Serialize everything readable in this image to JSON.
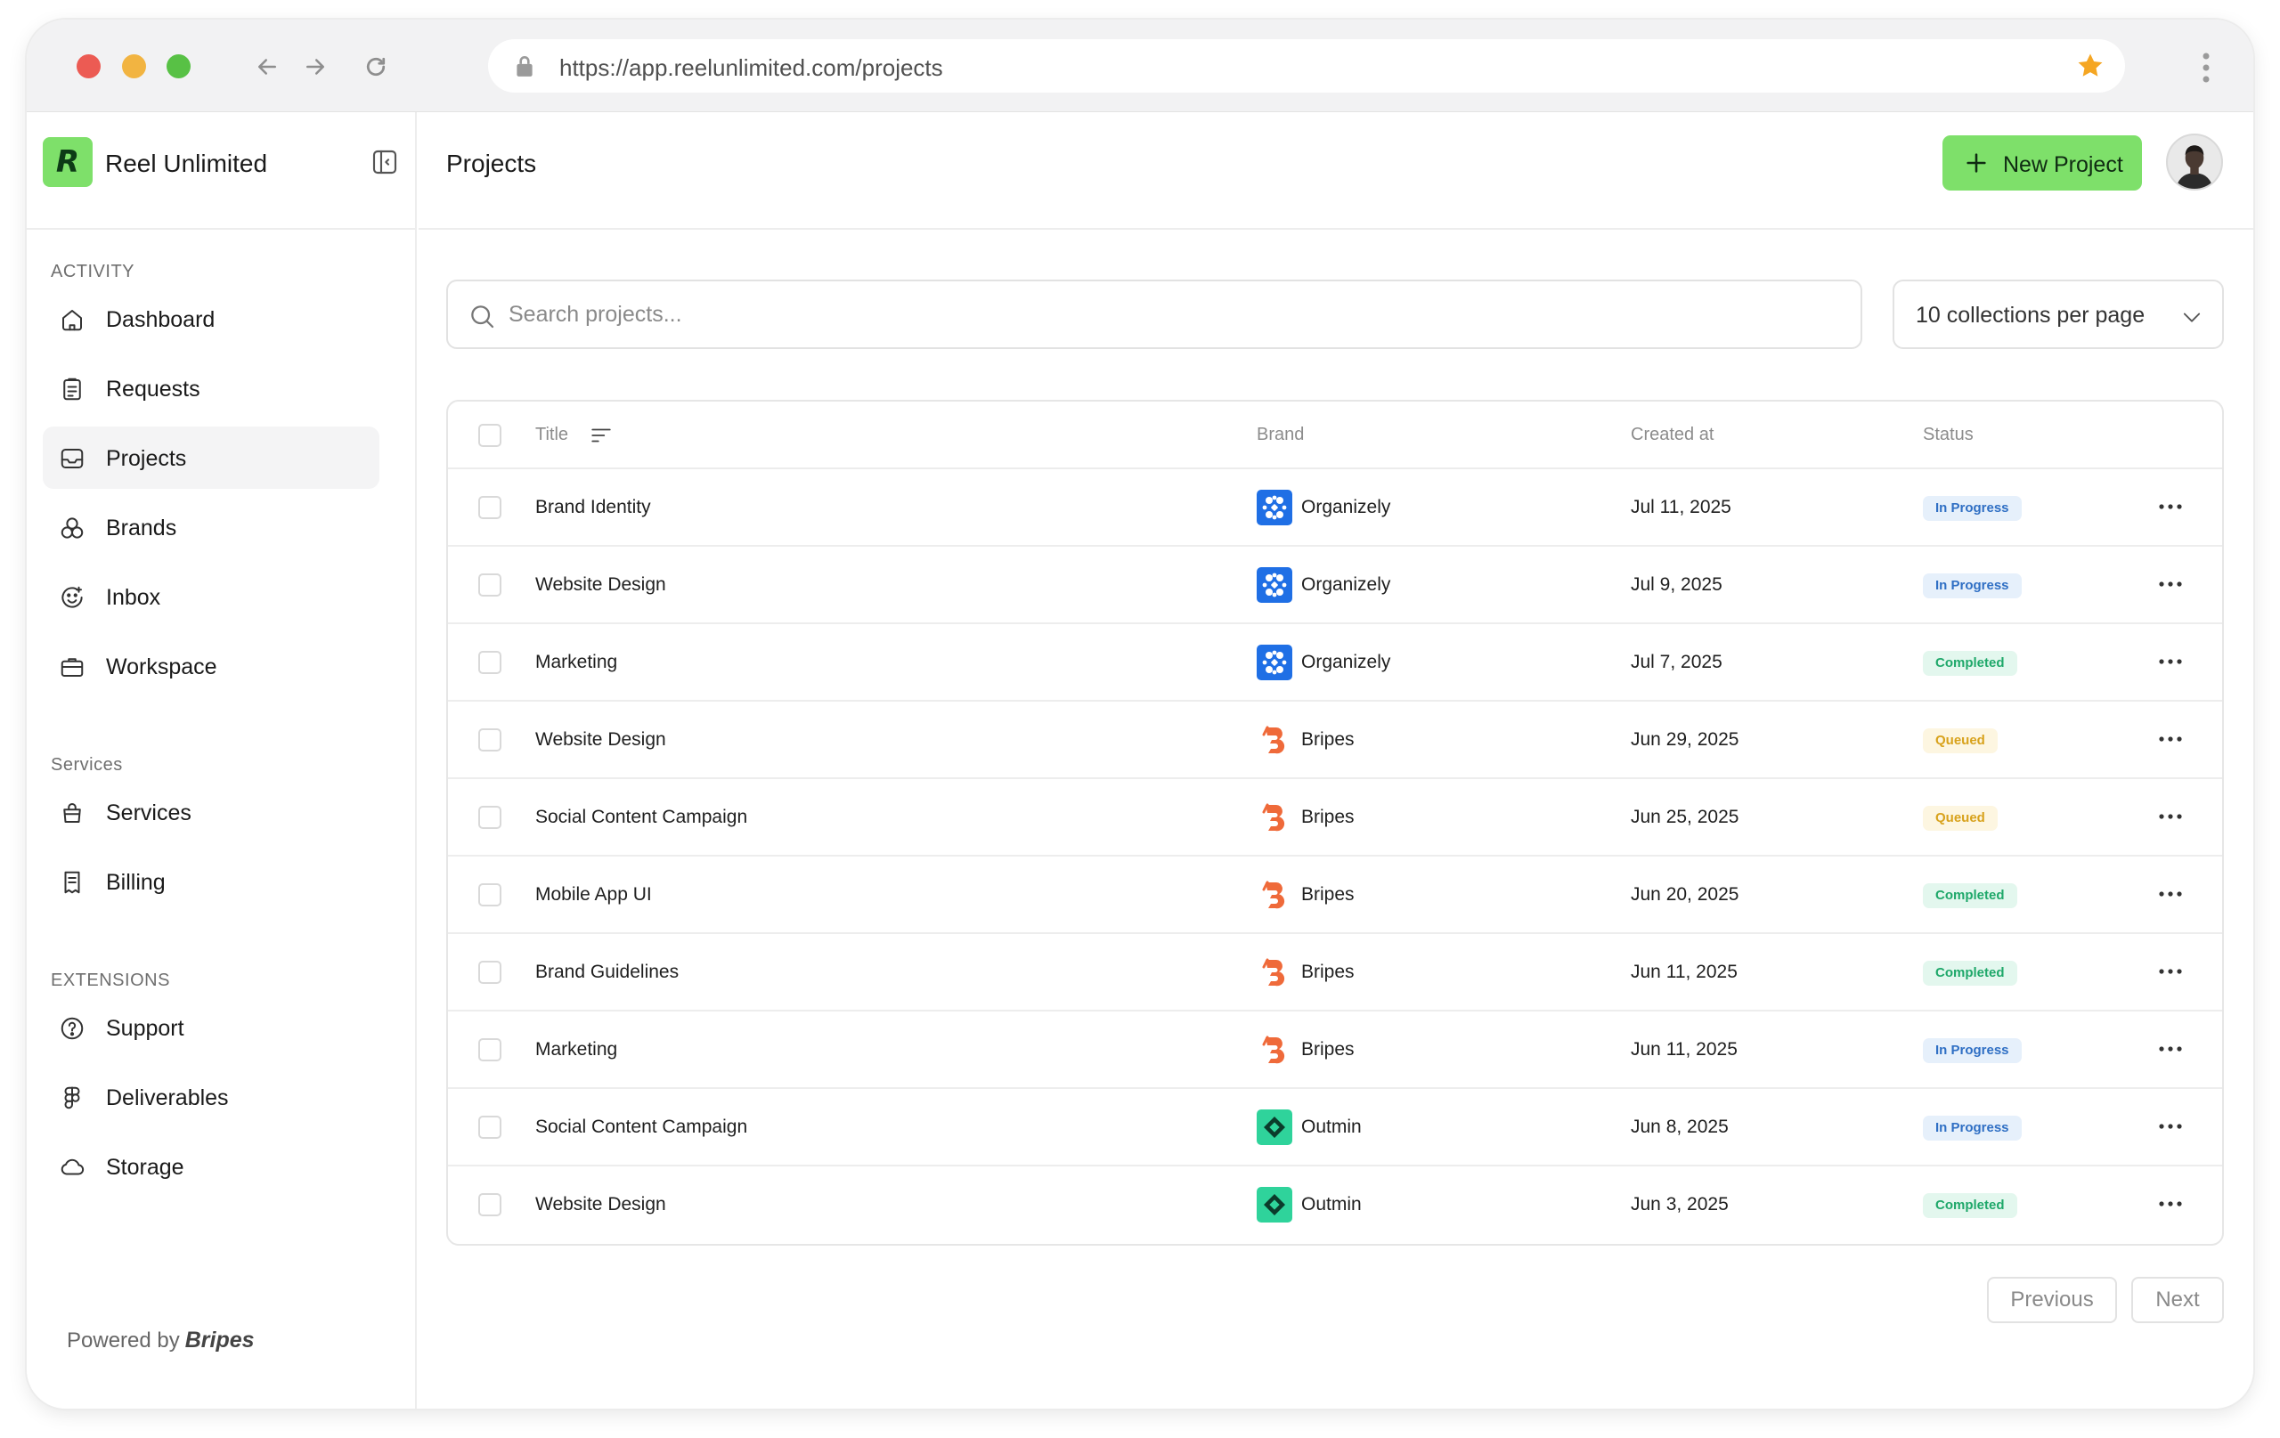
{
  "browser": {
    "url": "https://app.reelunlimited.com/projects"
  },
  "sidebar": {
    "logo_letter": "R",
    "app_name": "Reel Unlimited",
    "sections": [
      {
        "label": "ACTIVITY",
        "items": [
          {
            "label": "Dashboard",
            "icon": "home-icon"
          },
          {
            "label": "Requests",
            "icon": "clipboard-icon"
          },
          {
            "label": "Projects",
            "icon": "inbox-tray-icon",
            "active": true
          },
          {
            "label": "Brands",
            "icon": "shapes-icon"
          },
          {
            "label": "Inbox",
            "icon": "smile-chat-icon"
          },
          {
            "label": "Workspace",
            "icon": "briefcase-icon"
          }
        ]
      },
      {
        "label": "Services",
        "items": [
          {
            "label": "Services",
            "icon": "shopping-bag-icon"
          },
          {
            "label": "Billing",
            "icon": "receipt-icon"
          }
        ]
      },
      {
        "label": "EXTENSIONS",
        "items": [
          {
            "label": "Support",
            "icon": "question-circle-icon"
          },
          {
            "label": "Deliverables",
            "icon": "figma-icon"
          },
          {
            "label": "Storage",
            "icon": "cloud-icon"
          }
        ]
      }
    ],
    "powered_by": "Powered by",
    "powered_brand": "Bripes"
  },
  "header": {
    "title": "Projects",
    "new_button": "New Project"
  },
  "search": {
    "placeholder": "Search projects..."
  },
  "per_page": {
    "label": "10 collections per page"
  },
  "table": {
    "columns": {
      "title": "Title",
      "brand": "Brand",
      "created": "Created at",
      "status": "Status"
    },
    "rows": [
      {
        "title": "Brand Identity",
        "brand": "Organizely",
        "brand_logo": "organizely",
        "created": "Jul 11, 2025",
        "status": "In Progress"
      },
      {
        "title": "Website Design",
        "brand": "Organizely",
        "brand_logo": "organizely",
        "created": "Jul 9, 2025",
        "status": "In Progress"
      },
      {
        "title": "Marketing",
        "brand": "Organizely",
        "brand_logo": "organizely",
        "created": "Jul 7, 2025",
        "status": "Completed"
      },
      {
        "title": "Website Design",
        "brand": "Bripes",
        "brand_logo": "bripes",
        "created": "Jun 29, 2025",
        "status": "Queued"
      },
      {
        "title": "Social Content Campaign",
        "brand": "Bripes",
        "brand_logo": "bripes",
        "created": "Jun 25, 2025",
        "status": "Queued"
      },
      {
        "title": "Mobile App UI",
        "brand": "Bripes",
        "brand_logo": "bripes",
        "created": "Jun 20, 2025",
        "status": "Completed"
      },
      {
        "title": "Brand Guidelines",
        "brand": "Bripes",
        "brand_logo": "bripes",
        "created": "Jun 11, 2025",
        "status": "Completed"
      },
      {
        "title": "Marketing",
        "brand": "Bripes",
        "brand_logo": "bripes",
        "created": "Jun 11, 2025",
        "status": "In Progress"
      },
      {
        "title": "Social Content Campaign",
        "brand": "Outmin",
        "brand_logo": "outmin",
        "created": "Jun 8, 2025",
        "status": "In Progress"
      },
      {
        "title": "Website Design",
        "brand": "Outmin",
        "brand_logo": "outmin",
        "created": "Jun 3, 2025",
        "status": "Completed"
      }
    ]
  },
  "status_colors": {
    "In Progress": {
      "bg": "#e6f0fb",
      "fg": "#2f6fc4"
    },
    "Completed": {
      "bg": "#e3f7ee",
      "fg": "#1fa86a"
    },
    "Queued": {
      "bg": "#fdf6e1",
      "fg": "#d8a21c"
    }
  },
  "brand_colors": {
    "accent": "#7ee06a",
    "organizely": "#1f6fe5",
    "bripes": "#ef6a3a",
    "outmin": "#2fd39b"
  },
  "pagination": {
    "previous": "Previous",
    "next": "Next"
  }
}
